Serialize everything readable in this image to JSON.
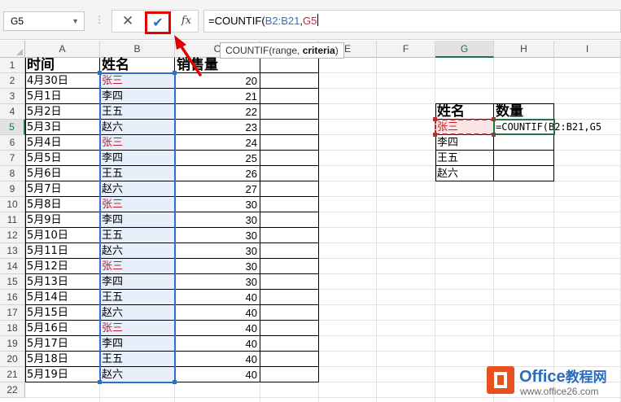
{
  "formula_bar": {
    "name_box": "G5",
    "cancel_icon": "✕",
    "enter_icon": "✔",
    "fx_label": "fx",
    "formula_prefix": "=COUNTIF(",
    "formula_range": "B2:B21",
    "formula_comma": ",",
    "formula_criteria": "G5"
  },
  "tooltip": {
    "prefix": "COUNTIF(range, ",
    "bold_arg": "criteria",
    "suffix": ")"
  },
  "columns": [
    "A",
    "B",
    "C",
    "D",
    "E",
    "F",
    "G",
    "H",
    "I"
  ],
  "rows": [
    "1",
    "2",
    "3",
    "4",
    "5",
    "6",
    "7",
    "8",
    "9",
    "10",
    "11",
    "12",
    "13",
    "14",
    "15",
    "16",
    "17",
    "18",
    "19",
    "20",
    "21",
    "22"
  ],
  "table_headers": {
    "date": "时间",
    "name": "姓名",
    "sales": "销售量"
  },
  "table_rows": [
    {
      "date": "4月30日",
      "name": "张三",
      "sales": "20"
    },
    {
      "date": "5月1日",
      "name": "李四",
      "sales": "21"
    },
    {
      "date": "5月2日",
      "name": "王五",
      "sales": "22"
    },
    {
      "date": "5月3日",
      "name": "赵六",
      "sales": "23"
    },
    {
      "date": "5月4日",
      "name": "张三",
      "sales": "24"
    },
    {
      "date": "5月5日",
      "name": "李四",
      "sales": "25"
    },
    {
      "date": "5月6日",
      "name": "王五",
      "sales": "26"
    },
    {
      "date": "5月7日",
      "name": "赵六",
      "sales": "27"
    },
    {
      "date": "5月8日",
      "name": "张三",
      "sales": "30"
    },
    {
      "date": "5月9日",
      "name": "李四",
      "sales": "30"
    },
    {
      "date": "5月10日",
      "name": "王五",
      "sales": "30"
    },
    {
      "date": "5月11日",
      "name": "赵六",
      "sales": "30"
    },
    {
      "date": "5月12日",
      "name": "张三",
      "sales": "30"
    },
    {
      "date": "5月13日",
      "name": "李四",
      "sales": "30"
    },
    {
      "date": "5月14日",
      "name": "王五",
      "sales": "40"
    },
    {
      "date": "5月15日",
      "name": "赵六",
      "sales": "40"
    },
    {
      "date": "5月16日",
      "name": "张三",
      "sales": "40"
    },
    {
      "date": "5月17日",
      "name": "李四",
      "sales": "40"
    },
    {
      "date": "5月18日",
      "name": "王五",
      "sales": "40"
    },
    {
      "date": "5月19日",
      "name": "赵六",
      "sales": "40"
    }
  ],
  "summary_table": {
    "header_name": "姓名",
    "header_count": "数量",
    "names": [
      "张三",
      "李四",
      "王五",
      "赵六"
    ],
    "editing_formula": "=COUNTIF(B2:B21,G5"
  },
  "watermark": {
    "brand": "Office",
    "brand_cn": "教程网",
    "url": "www.office26.com"
  },
  "colors": {
    "accent_red": "#c8202a",
    "range_blue": "#2f6ec9",
    "excel_green": "#217346",
    "annotation_red": "#e00000"
  }
}
